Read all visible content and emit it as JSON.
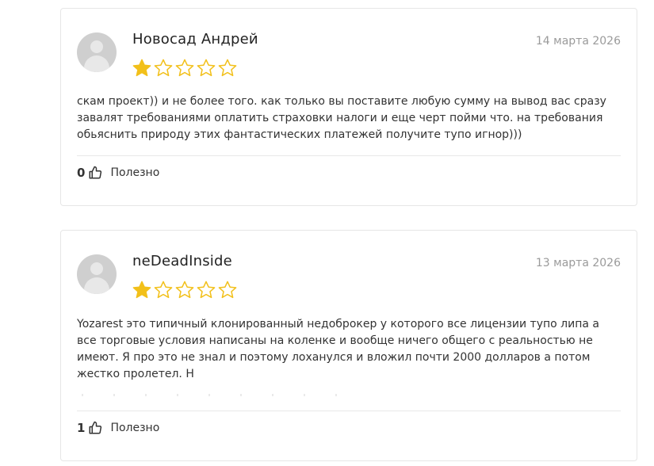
{
  "colors": {
    "star_filled": "#f2c01a",
    "star_empty_outline": "#f2c01a",
    "date": "#9a9a9a",
    "card_border": "#e6e6e6"
  },
  "reviews": [
    {
      "author": "Новосад Андрей",
      "date": "14 марта 2026",
      "rating": 1,
      "rating_max": 5,
      "text": "скам проект)) и не более того. как только вы поставите любую сумму на вывод вас сразу завалят требованиями оплатить страховки налоги и еще черт пойми что. на требования обьяснить природу этих фантастических платежей получите тупо игнор)))",
      "likes": "0",
      "useful_label": "Полезно"
    },
    {
      "author": "neDeadInside",
      "date": "13 марта 2026",
      "rating": 1,
      "rating_max": 5,
      "text": "Yozarest это типичный клонированный недоброкер у которого все лицензии тупо липа а все торговые условия написаны на коленке и вообще ничего общего с реальностью не имеют. Я про это не знал и поэтому лоханулся и вложил почти 2000 долларов а потом жестко пролетел. Н",
      "likes": "1",
      "useful_label": "Полезно"
    }
  ]
}
